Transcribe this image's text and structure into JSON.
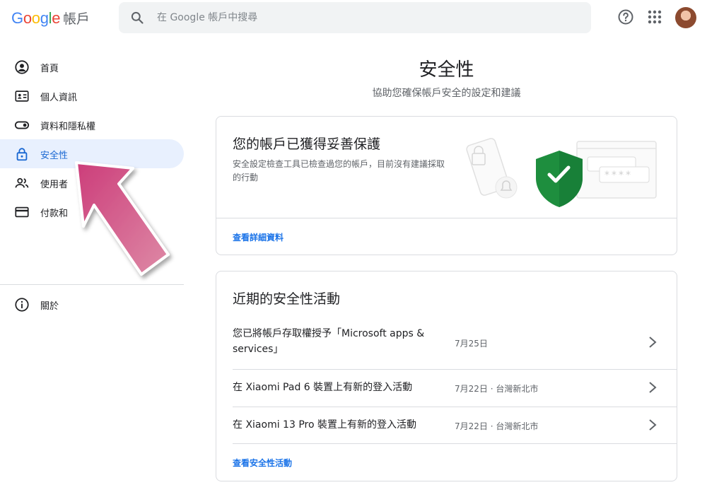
{
  "header": {
    "logo_letters": [
      "G",
      "o",
      "o",
      "g",
      "l",
      "e"
    ],
    "product": "帳戶",
    "search_placeholder": "在 Google 帳戶中搜尋",
    "icons": [
      "search-icon",
      "help-icon",
      "apps-icon",
      "avatar"
    ]
  },
  "sidebar": {
    "items": [
      {
        "label": "首頁",
        "icon": "home-account-icon"
      },
      {
        "label": "個人資訊",
        "icon": "id-card-icon"
      },
      {
        "label": "資料和隱私權",
        "icon": "toggle-icon"
      },
      {
        "label": "安全性",
        "icon": "lock-icon",
        "active": true
      },
      {
        "label": "使用者",
        "icon": "people-icon"
      },
      {
        "label": "付款和",
        "icon": "credit-card-icon"
      }
    ],
    "about": {
      "label": "關於",
      "icon": "info-icon"
    }
  },
  "main": {
    "title": "安全性",
    "subtitle": "協助您確保帳戶安全的設定和建議",
    "protection_card": {
      "title": "您的帳戶已獲得妥善保護",
      "description": "安全設定檢查工具已檢查過您的帳戶，目前沒有建議採取的行動",
      "link": "查看詳細資料",
      "password_mask": "****"
    },
    "activity_card": {
      "title": "近期的安全性活動",
      "rows": [
        {
          "text": "您已將帳戶存取權授予「Microsoft apps & services」",
          "meta": "7月25日"
        },
        {
          "text": "在 Xiaomi Pad 6 裝置上有新的登入活動",
          "meta": "7月22日 · 台灣新北市"
        },
        {
          "text": "在 Xiaomi 13 Pro 裝置上有新的登入活動",
          "meta": "7月22日 · 台灣新北市"
        }
      ],
      "link": "查看安全性活動"
    }
  },
  "colors": {
    "accent": "#1a73e8",
    "active_bg": "#e8f0fe",
    "shield_green": "#1e8e3e",
    "arrow_pink": "#d44b86"
  }
}
